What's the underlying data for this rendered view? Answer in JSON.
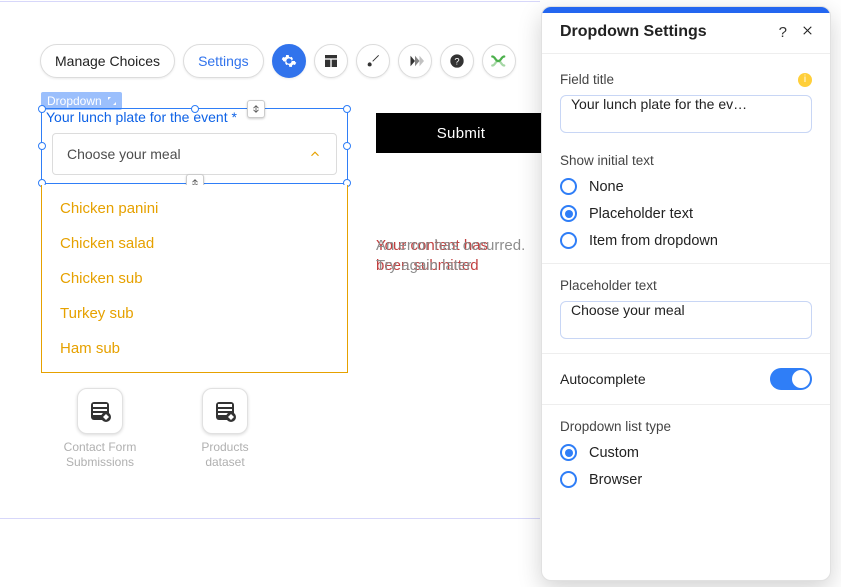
{
  "toolbar": {
    "manage_choices_label": "Manage Choices",
    "settings_label": "Settings",
    "icons": {
      "gear": "gear-icon",
      "layout": "layout-icon",
      "brush": "brush-icon",
      "animation": "animation-icon",
      "help": "help-icon",
      "dev": "dev-icon"
    }
  },
  "element_badge": {
    "type_label": "Dropdown"
  },
  "dropdown": {
    "label": "Your lunch plate for the event *",
    "placeholder_shown": "Choose your meal",
    "options": [
      "Chicken panini",
      "Chicken salad",
      "Chicken sub",
      "Turkey sub",
      "Ham sub"
    ]
  },
  "submit": {
    "label": "Submit"
  },
  "status_messages": {
    "error_line1": "Your content has",
    "error_line2": "been submitted",
    "grey_line1": "An error has occurred.",
    "grey_line2": "Try again later"
  },
  "datasets": {
    "d1_label_line1": "Contact Form",
    "d1_label_line2": "Submissions",
    "d2_label_line1": "Products",
    "d2_label_line2": "dataset"
  },
  "panel": {
    "title": "Dropdown Settings",
    "field_title_label": "Field title",
    "field_title_value": "Your lunch plate for the ev…",
    "show_initial_text_label": "Show initial text",
    "radio1": "None",
    "radio2": "Placeholder text",
    "radio3": "Item from dropdown",
    "selected_initial": "Placeholder text",
    "placeholder_text_label": "Placeholder text",
    "placeholder_text_value": "Choose your meal",
    "autocomplete_label": "Autocomplete",
    "autocomplete_on": true,
    "dropdown_list_type_label": "Dropdown list type",
    "list_type1": "Custom",
    "list_type2": "Browser",
    "selected_list_type": "Custom"
  }
}
